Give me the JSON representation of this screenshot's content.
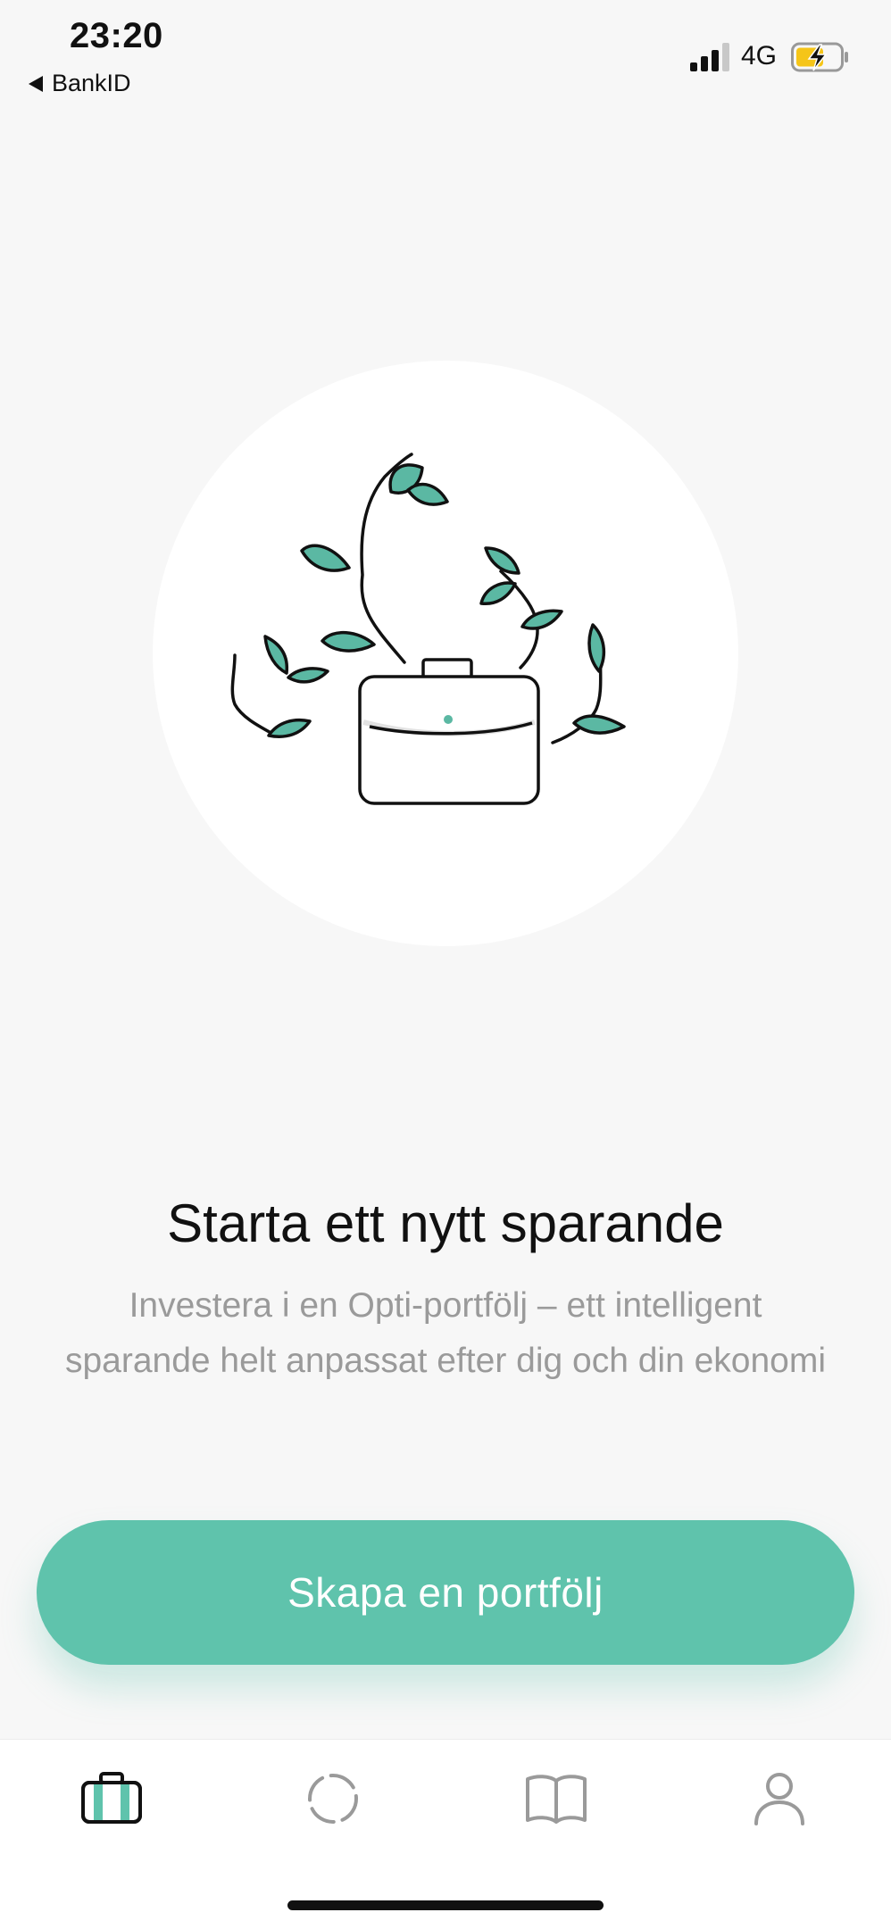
{
  "status_bar": {
    "time": "23:20",
    "back_app": "BankID",
    "network": "4G"
  },
  "hero": {
    "illustration": "briefcase-with-leaves-illustration"
  },
  "content": {
    "title": "Starta ett nytt sparande",
    "description": "Investera i en Opti-portfölj – ett intelligent sparande helt anpassat efter dig och din ekonomi"
  },
  "cta": {
    "label": "Skapa en portfölj"
  },
  "tabbar": {
    "tabs": [
      {
        "icon": "briefcase-icon",
        "active": true
      },
      {
        "icon": "loading-circle-icon",
        "active": false
      },
      {
        "icon": "book-icon",
        "active": false
      },
      {
        "icon": "person-icon",
        "active": false
      }
    ]
  },
  "colors": {
    "accent": "#5fc3ac",
    "leaf": "#5bb8a3",
    "background": "#f7f7f7",
    "battery_charge": "#f5c518"
  }
}
